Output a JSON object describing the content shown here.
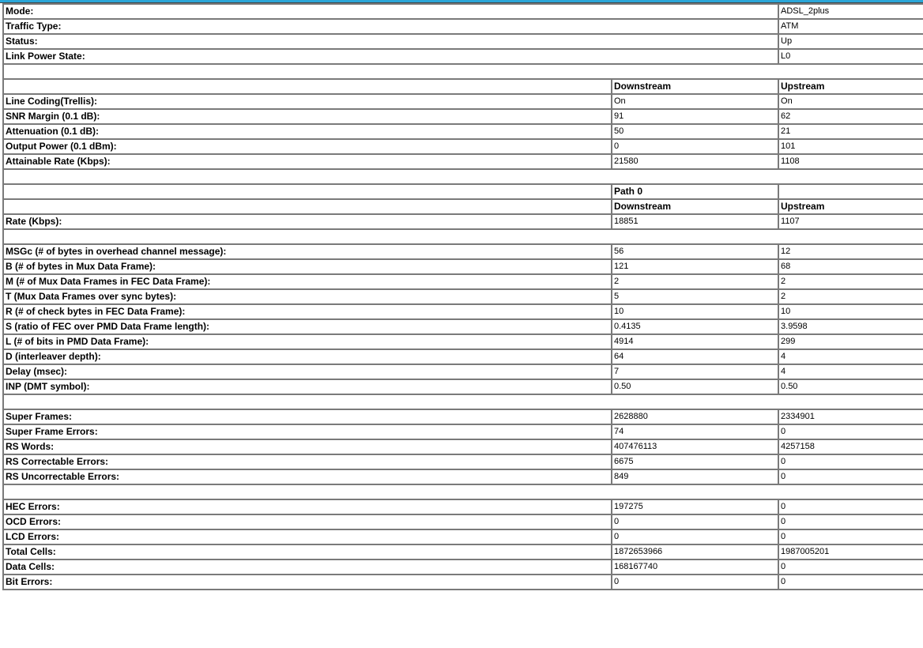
{
  "status": [
    {
      "label": "Mode:",
      "value": "ADSL_2plus"
    },
    {
      "label": "Traffic Type:",
      "value": "ATM"
    },
    {
      "label": "Status:",
      "value": "Up"
    },
    {
      "label": "Link Power State:",
      "value": "L0"
    }
  ],
  "line_header": {
    "downstream": "Downstream",
    "upstream": "Upstream"
  },
  "line": [
    {
      "label": "Line Coding(Trellis):",
      "down": "On",
      "up": "On"
    },
    {
      "label": "SNR Margin (0.1 dB):",
      "down": "91",
      "up": "62"
    },
    {
      "label": "Attenuation (0.1 dB):",
      "down": "50",
      "up": "21"
    },
    {
      "label": "Output Power (0.1 dBm):",
      "down": "0",
      "up": "101"
    },
    {
      "label": "Attainable Rate (Kbps):",
      "down": "21580",
      "up": "1108"
    }
  ],
  "path_header": {
    "path": "Path 0",
    "downstream": "Downstream",
    "upstream": "Upstream"
  },
  "rate": {
    "label": "Rate (Kbps):",
    "down": "18851",
    "up": "1107"
  },
  "framing": [
    {
      "label": "MSGc (# of bytes in overhead channel message):",
      "down": "56",
      "up": "12"
    },
    {
      "label": "B (# of bytes in Mux Data Frame):",
      "down": "121",
      "up": "68"
    },
    {
      "label": "M (# of Mux Data Frames in FEC Data Frame):",
      "down": "2",
      "up": "2"
    },
    {
      "label": "T (Mux Data Frames over sync bytes):",
      "down": "5",
      "up": "2"
    },
    {
      "label": "R (# of check bytes in FEC Data Frame):",
      "down": "10",
      "up": "10"
    },
    {
      "label": "S (ratio of FEC over PMD Data Frame length):",
      "down": "0.4135",
      "up": "3.9598"
    },
    {
      "label": "L (# of bits in PMD Data Frame):",
      "down": "4914",
      "up": "299"
    },
    {
      "label": "D (interleaver depth):",
      "down": "64",
      "up": "4"
    },
    {
      "label": "Delay (msec):",
      "down": "7",
      "up": "4"
    },
    {
      "label": "INP (DMT symbol):",
      "down": "0.50",
      "up": "0.50"
    }
  ],
  "frames": [
    {
      "label": "Super Frames:",
      "down": "2628880",
      "up": "2334901"
    },
    {
      "label": "Super Frame Errors:",
      "down": "74",
      "up": "0"
    },
    {
      "label": "RS Words:",
      "down": "407476113",
      "up": "4257158"
    },
    {
      "label": "RS Correctable Errors:",
      "down": "6675",
      "up": "0"
    },
    {
      "label": "RS Uncorrectable Errors:",
      "down": "849",
      "up": "0"
    }
  ],
  "cells": [
    {
      "label": "HEC Errors:",
      "down": "197275",
      "up": "0"
    },
    {
      "label": "OCD Errors:",
      "down": "0",
      "up": "0"
    },
    {
      "label": "LCD Errors:",
      "down": "0",
      "up": "0"
    },
    {
      "label": "Total Cells:",
      "down": "1872653966",
      "up": "1987005201"
    },
    {
      "label": "Data Cells:",
      "down": "168167740",
      "up": "0"
    },
    {
      "label": "Bit Errors:",
      "down": "0",
      "up": "0"
    }
  ]
}
